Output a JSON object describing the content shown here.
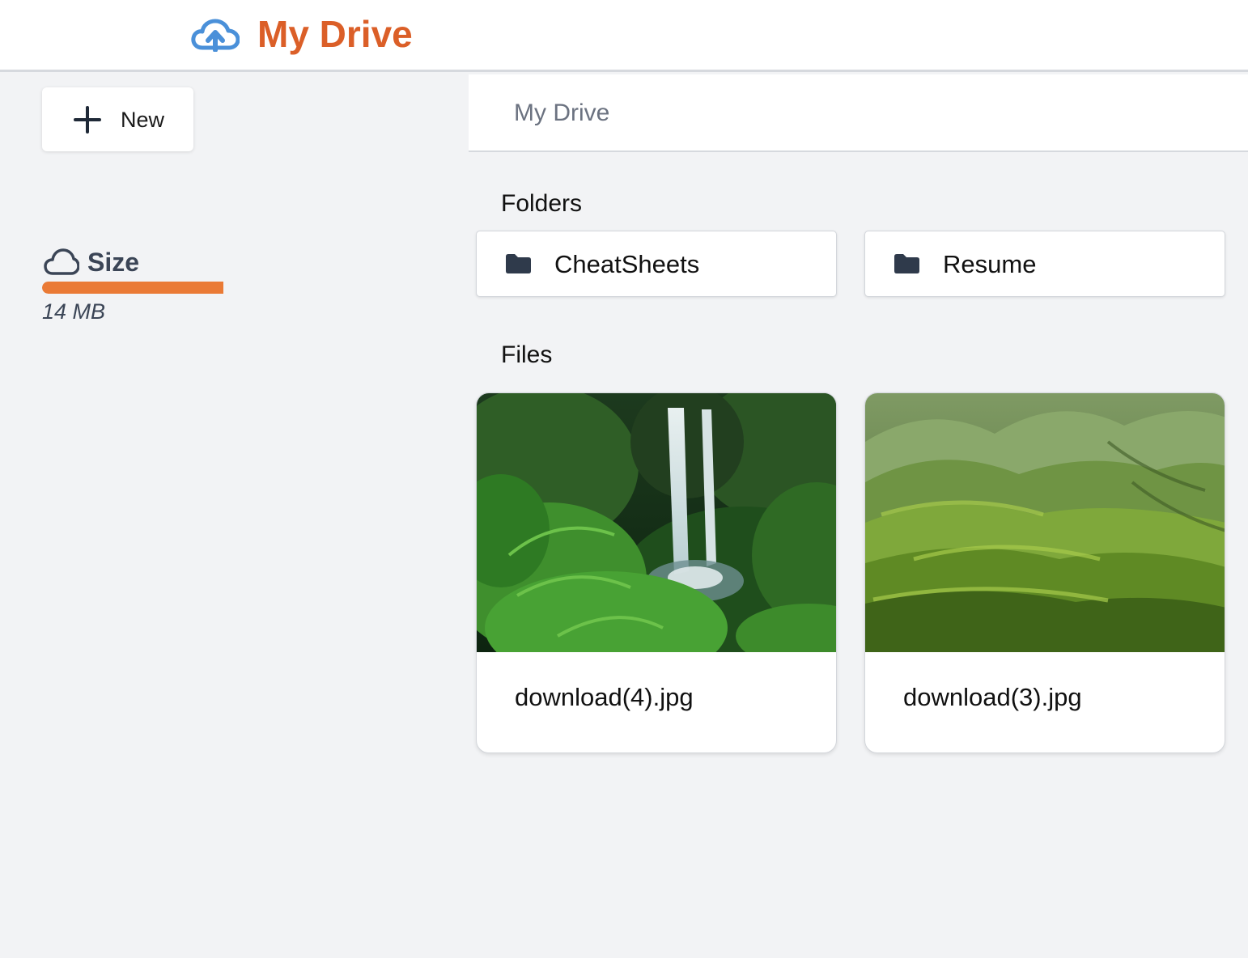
{
  "header": {
    "title": "My Drive",
    "logo_icon": "cloud-upload-icon",
    "title_color": "#db5f28",
    "logo_color": "#4a90d9"
  },
  "sidebar": {
    "new_button": {
      "label": "New",
      "icon": "plus-icon"
    },
    "storage": {
      "icon": "cloud-icon",
      "label": "Size",
      "value": "14 MB",
      "used_fraction": 1.0,
      "bar_color": "#ea7a35"
    }
  },
  "main": {
    "breadcrumb": "My Drive",
    "folders_heading": "Folders",
    "files_heading": "Files",
    "folders": [
      {
        "name": "CheatSheets",
        "icon": "folder-icon"
      },
      {
        "name": "Resume",
        "icon": "folder-icon"
      }
    ],
    "files": [
      {
        "name": "download(4).jpg",
        "thumbnail": "waterfall-jungle-image"
      },
      {
        "name": "download(3).jpg",
        "thumbnail": "green-mountains-image"
      }
    ]
  }
}
